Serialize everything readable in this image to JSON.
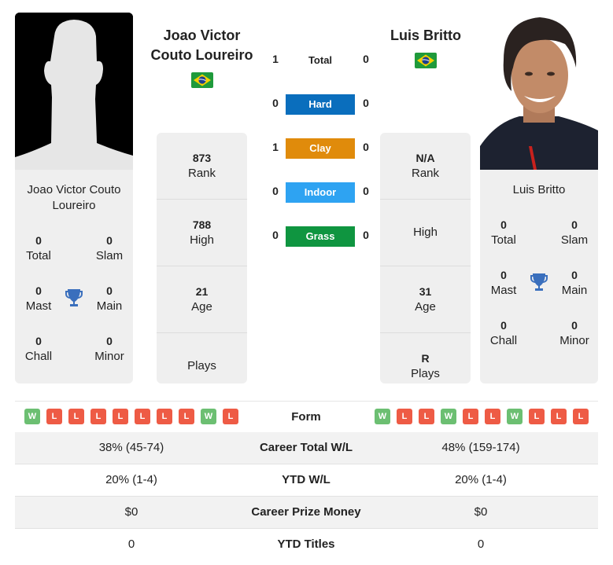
{
  "player1": {
    "name_header": [
      "Joao Victor",
      "Couto Loureiro"
    ],
    "name_card": [
      "Joao Victor Couto",
      "Loureiro"
    ],
    "country_flag": "brazil-flag",
    "photo": "silhouette-placeholder",
    "titles": {
      "total": {
        "value": "0",
        "label": "Total"
      },
      "slam": {
        "value": "0",
        "label": "Slam"
      },
      "mast": {
        "value": "0",
        "label": "Mast"
      },
      "main": {
        "value": "0",
        "label": "Main"
      },
      "chall": {
        "value": "0",
        "label": "Chall"
      },
      "minor": {
        "value": "0",
        "label": "Minor"
      }
    },
    "info": {
      "rank": {
        "value": "873",
        "label": "Rank"
      },
      "high": {
        "value": "788",
        "label": "High"
      },
      "age": {
        "value": "21",
        "label": "Age"
      },
      "plays": {
        "value": "",
        "label": "Plays"
      }
    },
    "form": [
      "W",
      "L",
      "L",
      "L",
      "L",
      "L",
      "L",
      "L",
      "W",
      "L"
    ]
  },
  "player2": {
    "name_header": [
      "Luis Britto"
    ],
    "name_card": [
      "Luis Britto"
    ],
    "country_flag": "brazil-flag",
    "photo": "player-photo",
    "titles": {
      "total": {
        "value": "0",
        "label": "Total"
      },
      "slam": {
        "value": "0",
        "label": "Slam"
      },
      "mast": {
        "value": "0",
        "label": "Mast"
      },
      "main": {
        "value": "0",
        "label": "Main"
      },
      "chall": {
        "value": "0",
        "label": "Chall"
      },
      "minor": {
        "value": "0",
        "label": "Minor"
      }
    },
    "info": {
      "rank": {
        "value": "N/A",
        "label": "Rank"
      },
      "high": {
        "value": "",
        "label": "High"
      },
      "age": {
        "value": "31",
        "label": "Age"
      },
      "plays": {
        "value": "R",
        "label": "Plays"
      }
    },
    "form": [
      "W",
      "L",
      "L",
      "W",
      "L",
      "L",
      "W",
      "L",
      "L",
      "L"
    ]
  },
  "h2h": {
    "total": {
      "label": "Total",
      "p1": "1",
      "p2": "0"
    },
    "surfaces": [
      {
        "label": "Hard",
        "p1": "0",
        "p2": "0",
        "color": "#0a6ebd"
      },
      {
        "label": "Clay",
        "p1": "1",
        "p2": "0",
        "color": "#e08b0b"
      },
      {
        "label": "Indoor",
        "p1": "0",
        "p2": "0",
        "color": "#2ea3f2"
      },
      {
        "label": "Grass",
        "p1": "0",
        "p2": "0",
        "color": "#0f9540"
      }
    ]
  },
  "form_label": "Form",
  "colors": {
    "win": "#6cbf72",
    "loss": "#ee5b45",
    "trophy": "#3a6fbd"
  },
  "comparison": [
    {
      "label": "Career Total W/L",
      "p1": "38% (45-74)",
      "p2": "48% (159-174)"
    },
    {
      "label": "YTD W/L",
      "p1": "20% (1-4)",
      "p2": "20% (1-4)"
    },
    {
      "label": "Career Prize Money",
      "p1": "$0",
      "p2": "$0"
    },
    {
      "label": "YTD Titles",
      "p1": "0",
      "p2": "0"
    }
  ]
}
